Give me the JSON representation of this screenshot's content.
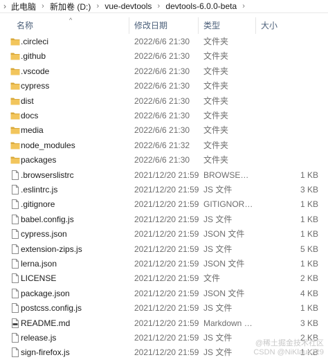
{
  "breadcrumb": {
    "lead": "›",
    "separator": "›",
    "segments": [
      "此电脑",
      "新加卷 (D:)",
      "vue-devtools",
      "devtools-6.0.0-beta"
    ]
  },
  "columns": {
    "name": "名称",
    "date": "修改日期",
    "type": "类型",
    "size": "大小"
  },
  "sort_indicator": "^",
  "files": [
    {
      "name": ".circleci",
      "date": "2022/6/6 21:30",
      "type": "文件夹",
      "size": "",
      "icon": "folder-icon"
    },
    {
      "name": ".github",
      "date": "2022/6/6 21:30",
      "type": "文件夹",
      "size": "",
      "icon": "folder-icon"
    },
    {
      "name": ".vscode",
      "date": "2022/6/6 21:30",
      "type": "文件夹",
      "size": "",
      "icon": "folder-icon"
    },
    {
      "name": "cypress",
      "date": "2022/6/6 21:30",
      "type": "文件夹",
      "size": "",
      "icon": "folder-icon"
    },
    {
      "name": "dist",
      "date": "2022/6/6 21:30",
      "type": "文件夹",
      "size": "",
      "icon": "folder-icon"
    },
    {
      "name": "docs",
      "date": "2022/6/6 21:30",
      "type": "文件夹",
      "size": "",
      "icon": "folder-icon"
    },
    {
      "name": "media",
      "date": "2022/6/6 21:30",
      "type": "文件夹",
      "size": "",
      "icon": "folder-icon"
    },
    {
      "name": "node_modules",
      "date": "2022/6/6 21:32",
      "type": "文件夹",
      "size": "",
      "icon": "folder-icon"
    },
    {
      "name": "packages",
      "date": "2022/6/6 21:30",
      "type": "文件夹",
      "size": "",
      "icon": "folder-icon"
    },
    {
      "name": ".browserslistrc",
      "date": "2021/12/20 21:59",
      "type": "BROWSERSLIST...",
      "size": "1 KB",
      "icon": "file-icon"
    },
    {
      "name": ".eslintrc.js",
      "date": "2021/12/20 21:59",
      "type": "JS 文件",
      "size": "3 KB",
      "icon": "file-icon"
    },
    {
      "name": ".gitignore",
      "date": "2021/12/20 21:59",
      "type": "GITIGNORE 文件",
      "size": "1 KB",
      "icon": "file-icon"
    },
    {
      "name": "babel.config.js",
      "date": "2021/12/20 21:59",
      "type": "JS 文件",
      "size": "1 KB",
      "icon": "file-icon"
    },
    {
      "name": "cypress.json",
      "date": "2021/12/20 21:59",
      "type": "JSON 文件",
      "size": "1 KB",
      "icon": "file-icon"
    },
    {
      "name": "extension-zips.js",
      "date": "2021/12/20 21:59",
      "type": "JS 文件",
      "size": "5 KB",
      "icon": "file-icon"
    },
    {
      "name": "lerna.json",
      "date": "2021/12/20 21:59",
      "type": "JSON 文件",
      "size": "1 KB",
      "icon": "file-icon"
    },
    {
      "name": "LICENSE",
      "date": "2021/12/20 21:59",
      "type": "文件",
      "size": "2 KB",
      "icon": "file-icon"
    },
    {
      "name": "package.json",
      "date": "2021/12/20 21:59",
      "type": "JSON 文件",
      "size": "4 KB",
      "icon": "file-icon"
    },
    {
      "name": "postcss.config.js",
      "date": "2021/12/20 21:59",
      "type": "JS 文件",
      "size": "1 KB",
      "icon": "file-icon"
    },
    {
      "name": "README.md",
      "date": "2021/12/20 21:59",
      "type": "Markdown File",
      "size": "3 KB",
      "icon": "markdown-file-icon"
    },
    {
      "name": "release.js",
      "date": "2021/12/20 21:59",
      "type": "JS 文件",
      "size": "2 KB",
      "icon": "file-icon"
    },
    {
      "name": "sign-firefox.js",
      "date": "2021/12/20 21:59",
      "type": "JS 文件",
      "size": "1 KB",
      "icon": "file-icon"
    }
  ],
  "watermark": {
    "line1": "@稀土掘金技术社区",
    "line2": "CSDN @NiKlaus729"
  },
  "colors": {
    "folder": "#f2c55c",
    "folder_dark": "#d9a93b",
    "header_text": "#4c607a"
  }
}
